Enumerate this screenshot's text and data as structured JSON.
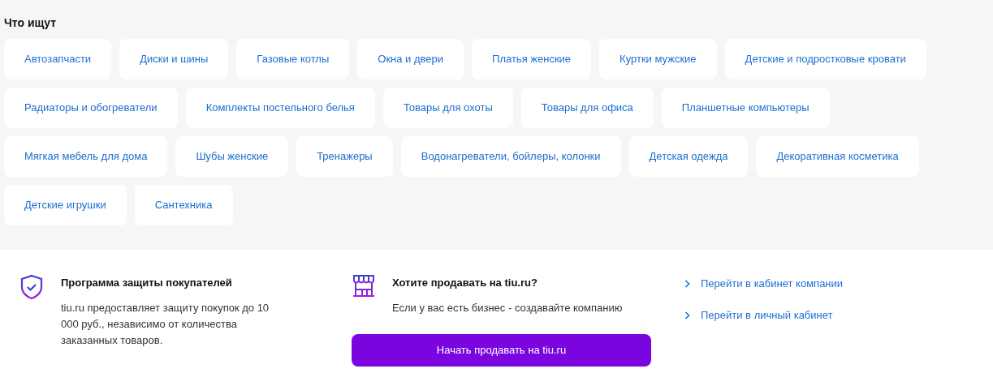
{
  "popular_searches": {
    "title": "Что ищут",
    "rows": [
      {
        "tags": [
          "Автозапчасти",
          "Диски и шины",
          "Газовые котлы",
          "Окна и двери",
          "Платья женские",
          "Куртки мужские",
          "Детские и подростковые кровати"
        ]
      },
      {
        "tags": [
          "Радиаторы и обогреватели",
          "Комплекты постельного белья",
          "Товары для охоты",
          "Товары для офиса",
          "Планшетные компьютеры"
        ]
      },
      {
        "tags": [
          "Мягкая мебель для дома",
          "Шубы женские",
          "Тренажеры",
          "Водонагреватели, бойлеры, колонки",
          "Детская одежда",
          "Декоративная косметика"
        ]
      },
      {
        "tags": [
          "Детские игрушки",
          "Сантехника"
        ]
      }
    ]
  },
  "footer": {
    "protection": {
      "title": "Программа защиты покупателей",
      "text": "tiu.ru предоставляет защиту покупок до 10 000 руб., независимо от количества заказанных товаров."
    },
    "sell": {
      "title": "Хотите продавать на tiu.ru?",
      "text": "Если у вас есть бизнес - создавайте компанию",
      "button": "Начать продавать на tiu.ru"
    },
    "links": [
      "Перейти в кабинет компании",
      "Перейти в личный кабинет"
    ]
  }
}
